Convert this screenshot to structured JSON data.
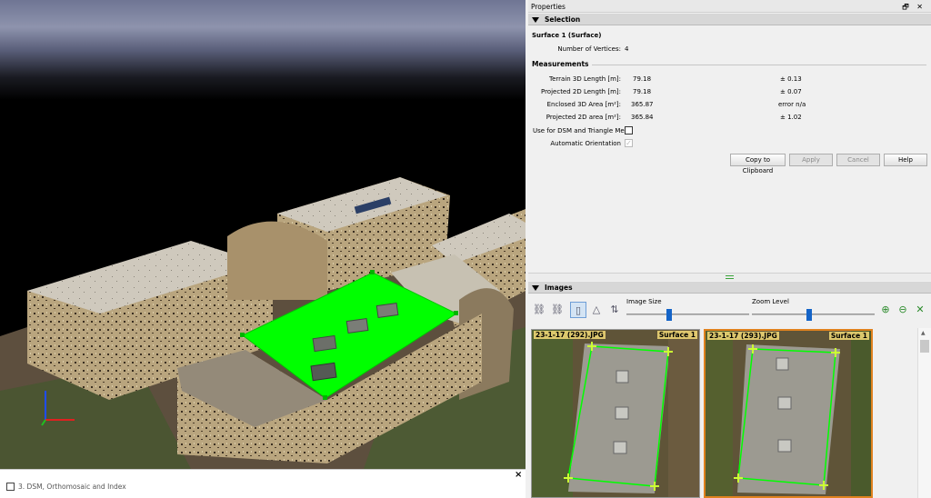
{
  "viewport": {
    "close_label": "×",
    "layer_label": "3. DSM, Orthomosaic and Index"
  },
  "properties": {
    "panel_title": "Properties",
    "panel_buttons": "🗗 ✕",
    "selection_header": "Selection",
    "surface_name": "Surface 1 (Surface)",
    "vertices_label": "Number of Vertices:",
    "vertices_value": "4",
    "measurements_header": "Measurements",
    "measurements": [
      {
        "label": "Terrain 3D Length [m]:",
        "value": "79.18",
        "error": "± 0.13"
      },
      {
        "label": "Projected 2D Length [m]:",
        "value": "79.18",
        "error": "± 0.07"
      },
      {
        "label": "Enclosed 3D Area [m²]:",
        "value": "365.87",
        "error": "error n/a"
      },
      {
        "label": "Projected 2D area [m²]:",
        "value": "365.84",
        "error": "± 1.02"
      }
    ],
    "dsm_label": "Use for DSM and Triangle Mesh",
    "auto_orient_label": "Automatic Orientation",
    "buttons": {
      "copy": "Copy to Clipboard",
      "apply": "Apply",
      "cancel": "Cancel",
      "help": "Help"
    }
  },
  "images": {
    "header": "Images",
    "image_size_label": "Image Size",
    "zoom_level_label": "Zoom Level",
    "image_size_level": 0.32,
    "zoom_level": 0.46,
    "thumbnails": [
      {
        "name": "23-1-17 (292).JPG",
        "tag": "Surface 1"
      },
      {
        "name": "23-1-17 (293).JPG",
        "tag": "Surface 1"
      }
    ]
  },
  "colors": {
    "surface_fill": "#00ff00",
    "accent": "#1464c8"
  }
}
